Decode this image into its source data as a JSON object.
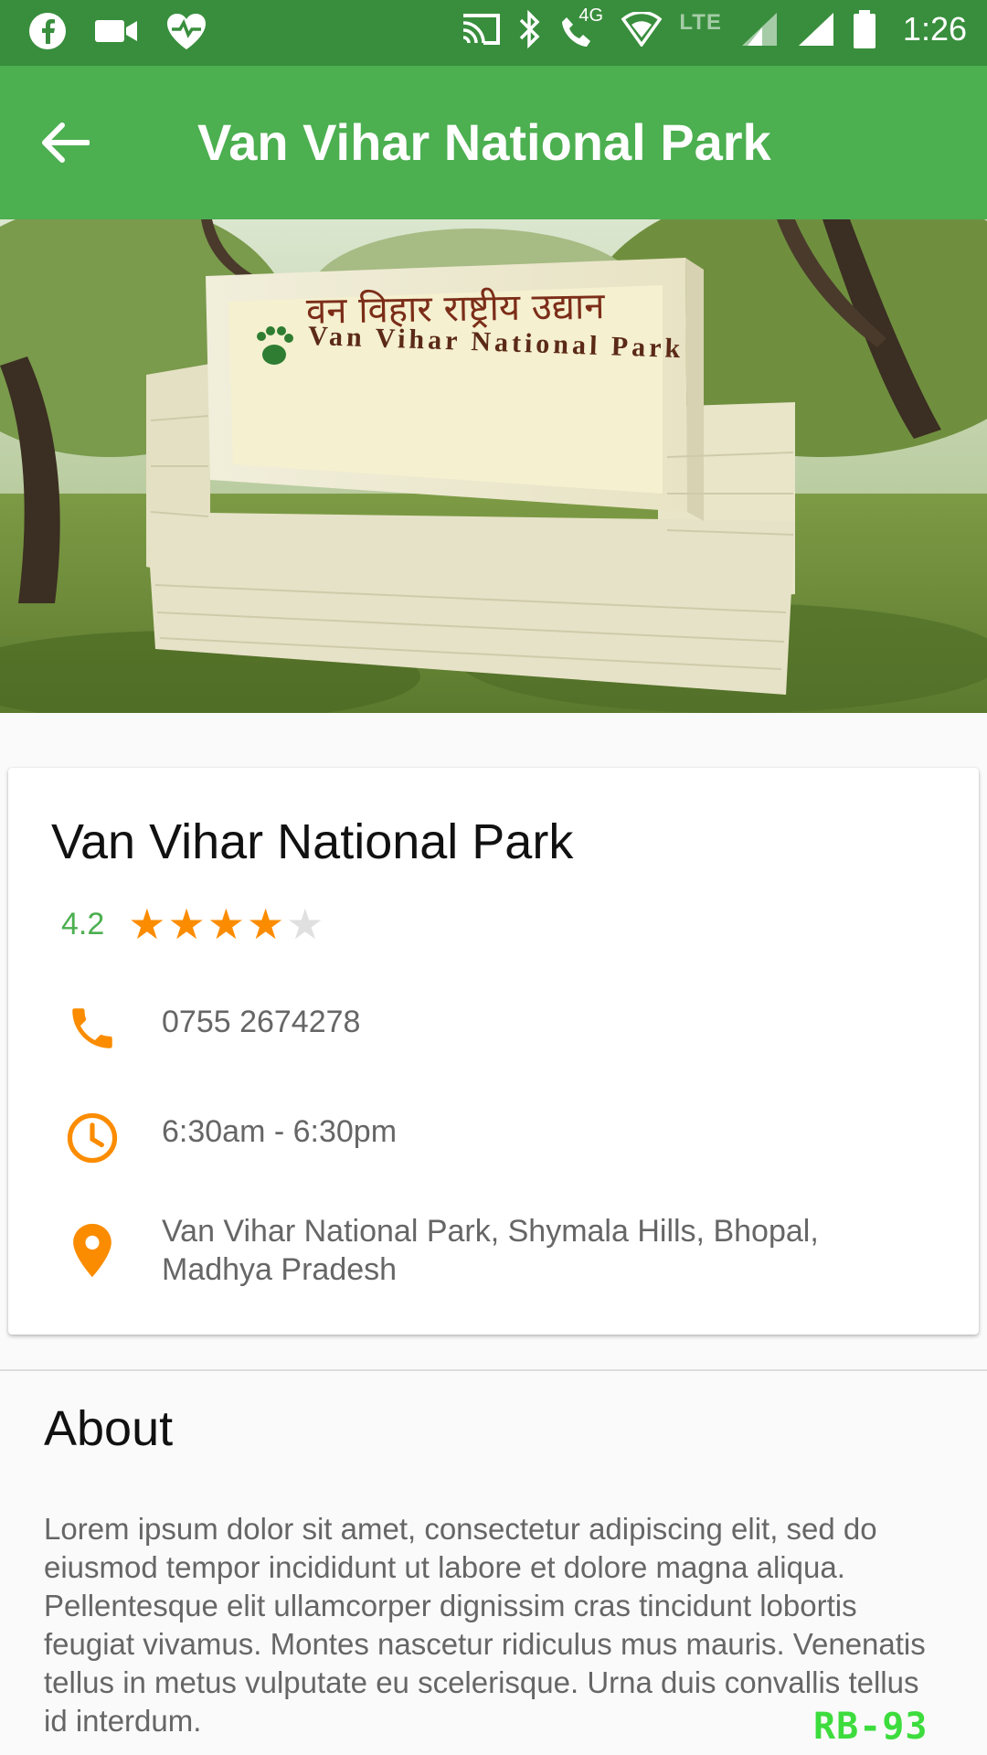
{
  "status_bar": {
    "time": "1:26",
    "network_label": "4G",
    "lte_label": "LTE",
    "left_icons": [
      "facebook-icon",
      "video-call-icon",
      "heart-health-icon"
    ],
    "right_icons": [
      "cast-icon",
      "bluetooth-icon",
      "wifi-call-icon",
      "data-icon",
      "signal-icon",
      "signal-icon",
      "battery-icon"
    ]
  },
  "app_bar": {
    "title": "Van Vihar National Park",
    "back_icon": "arrow-back-icon",
    "color": "#4caf50",
    "status_color": "#388e3c"
  },
  "hero": {
    "sign_text_hindi": "वन विहार राष्ट्रीय उद्यान",
    "sign_text_english": "Van Vihar National Park"
  },
  "details": {
    "name": "Van Vihar National Park",
    "rating": "4.2",
    "stars_filled": 4,
    "stars_total": 5,
    "phone": "0755 2674278",
    "hours": "6:30am - 6:30pm",
    "address": "Van Vihar National Park, Shymala Hills, Bhopal, Madhya Pradesh",
    "accent_color": "#fb8c00"
  },
  "about": {
    "title": "About",
    "body": "Lorem ipsum dolor sit amet, consectetur adipiscing elit, sed do eiusmod tempor incididunt ut labore et dolore magna aliqua. Pellentesque elit ullamcorper dignissim cras tincidunt lobortis feugiat vivamus. Montes nascetur ridiculus mus mauris. Venenatis tellus in metus vulputate eu scelerisque. Urna duis convallis tellus id interdum."
  },
  "watermark": "RB-93"
}
